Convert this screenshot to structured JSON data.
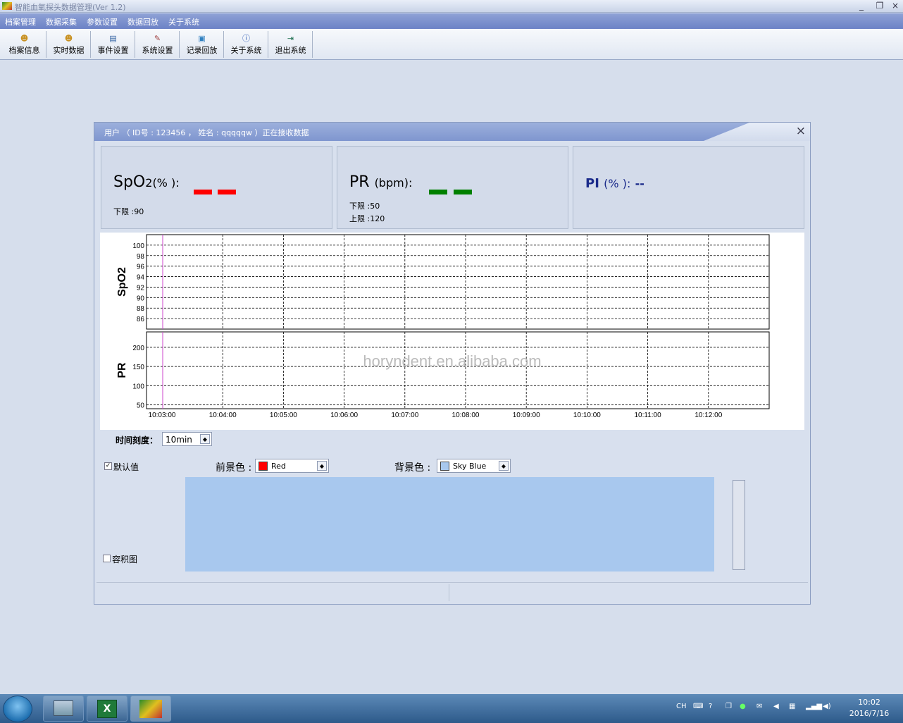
{
  "app": {
    "title": "智能血氧探头数据管理(Ver 1.2)",
    "win_min": "_",
    "win_restore": "❐",
    "win_close": "×"
  },
  "menu": [
    "档案管理",
    "数据采集",
    "参数设置",
    "数据回放",
    "关于系统"
  ],
  "toolbar": [
    {
      "label": "档案信息",
      "icon": "user-profile-icon"
    },
    {
      "label": "实时数据",
      "icon": "realtime-user-icon"
    },
    {
      "label": "事件设置",
      "icon": "event-settings-icon"
    },
    {
      "label": "系统设置",
      "icon": "system-tools-icon"
    },
    {
      "label": "记录回放",
      "icon": "record-playback-icon"
    },
    {
      "label": "关于系统",
      "icon": "info-icon"
    },
    {
      "label": "退出系统",
      "icon": "exit-door-icon"
    }
  ],
  "dialog": {
    "title": "用户 （ ID号 : 123456 ，   姓名 : qqqqqw ）正在接收数据",
    "close": "×"
  },
  "params": {
    "spo2": {
      "name": "SpO",
      "sub": "2",
      "unit": "(% ):",
      "lower": "下限 :90",
      "color": "#ff0000"
    },
    "pr": {
      "name": "PR",
      "unit": "(bpm):",
      "lower": "下限 :50",
      "upper": "上限 :120",
      "color": "#008000"
    },
    "pi": {
      "name": "PI",
      "unit": "(% ):",
      "value": "--",
      "color": "#1a2a8a"
    }
  },
  "chart_data": {
    "type": "line",
    "panels": [
      {
        "ylabel": "SpO2",
        "yticks": [
          100,
          98,
          96,
          94,
          92,
          90,
          88,
          86
        ],
        "ylim": [
          84,
          102
        ]
      },
      {
        "ylabel": "PR",
        "yticks": [
          200,
          150,
          100,
          50
        ],
        "ylim": [
          40,
          240
        ]
      }
    ],
    "x": [
      "10:03:00",
      "10:04:00",
      "10:05:00",
      "10:06:00",
      "10:07:00",
      "10:08:00",
      "10:09:00",
      "10:10:00",
      "10:11:00",
      "10:12:00"
    ],
    "cursor_time": "10:03:00",
    "series": [],
    "grid": true,
    "cursor_color": "#cc44cc"
  },
  "controls": {
    "time_scale_label": "时间刻度：",
    "time_scale_value": "10min",
    "default_label": "默认值",
    "default_checked": true,
    "fg_label": "前景色 :",
    "fg_value": "Red",
    "fg_swatch": "#ff0000",
    "bg_label": "背景色 :",
    "bg_value": "Sky Blue",
    "bg_swatch": "#a8c8ee",
    "volume_label": "容积图",
    "volume_checked": false
  },
  "watermark": "horyndent.en.alibaba.com",
  "taskbar": {
    "tray_lang": "CH",
    "time": "10:02",
    "date": "2016/7/16"
  }
}
